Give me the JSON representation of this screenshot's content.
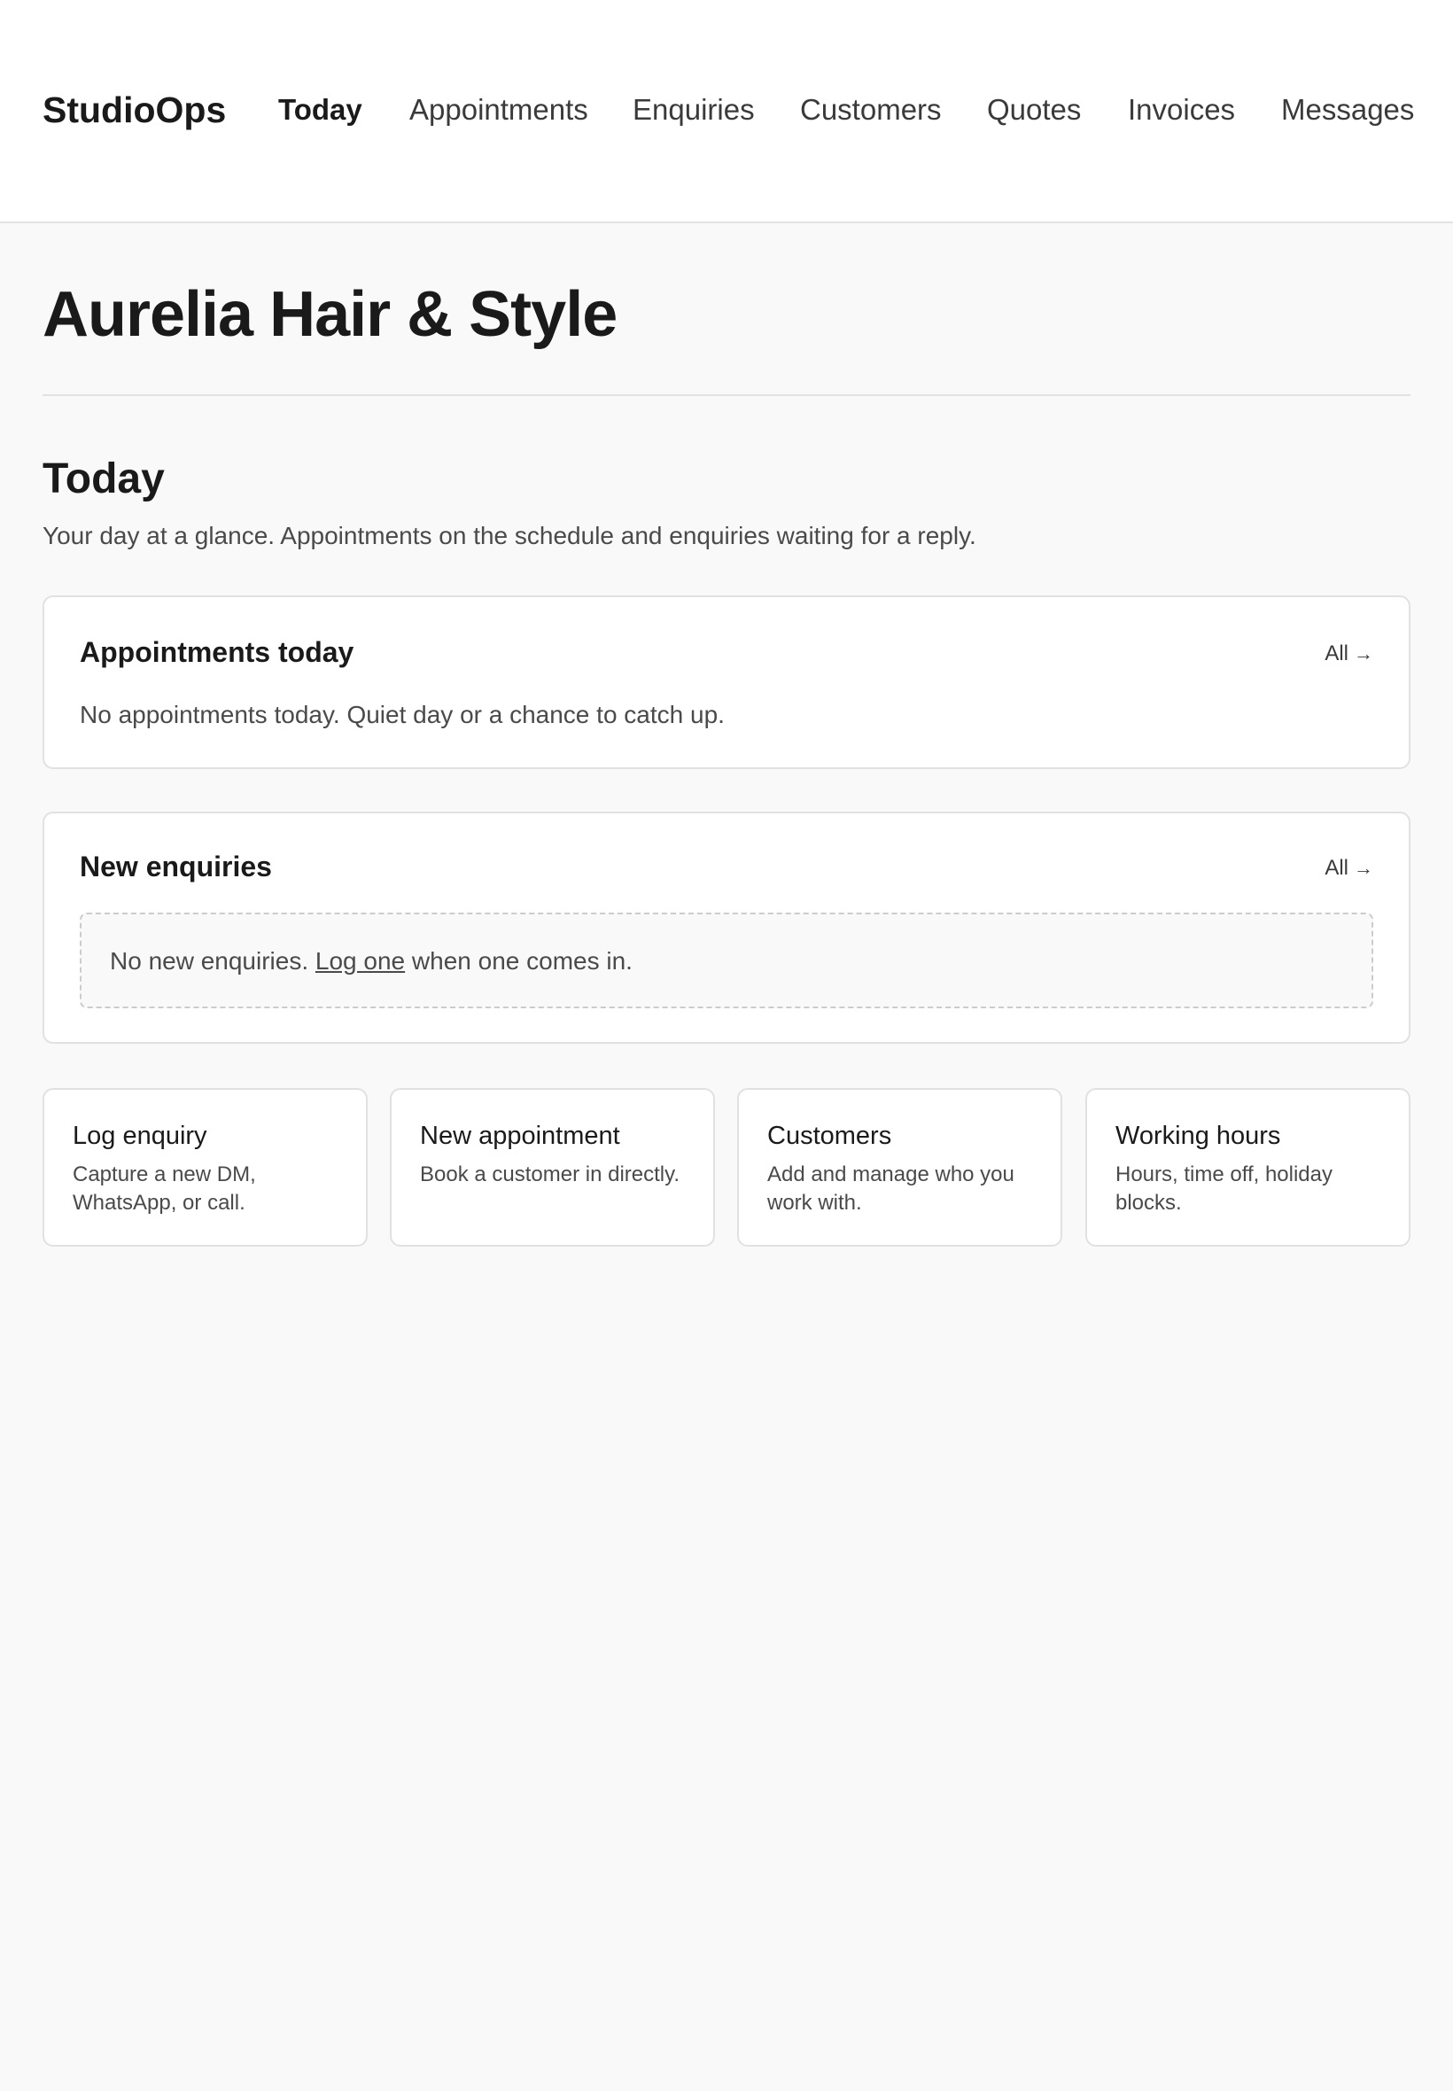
{
  "app": {
    "brand": "StudioOps"
  },
  "nav": {
    "items": [
      {
        "label": "Today",
        "active": true
      },
      {
        "label": "Appointments",
        "active": false
      },
      {
        "label": "Enquiries",
        "active": false
      },
      {
        "label": "Customers",
        "active": false
      },
      {
        "label": "Quotes",
        "active": false
      },
      {
        "label": "Invoices",
        "active": false
      },
      {
        "label": "Messages",
        "active": false
      }
    ]
  },
  "page": {
    "business_name": "Aurelia Hair & Style",
    "section_title": "Today",
    "section_subtitle": "Your day at a glance. Appointments on the schedule and enquiries waiting for a reply."
  },
  "appointments_card": {
    "title": "Appointments today",
    "link_label": "All",
    "empty_text": "No appointments today. Quiet day or a chance to catch up."
  },
  "enquiries_card": {
    "title": "New enquiries",
    "link_label": "All",
    "empty_prefix": "No new enquiries.",
    "empty_link": "Log one",
    "empty_suffix": "when one comes in."
  },
  "quick_actions": [
    {
      "title": "Log enquiry",
      "description": "Capture a new DM, WhatsApp, or call."
    },
    {
      "title": "New appointment",
      "description": "Book a customer in directly."
    },
    {
      "title": "Customers",
      "description": "Add and manage who you work with."
    },
    {
      "title": "Working hours",
      "description": "Hours, time off, holiday blocks."
    }
  ],
  "icons": {
    "card_link_arrow": "arrow-right-icon"
  },
  "colors": {
    "background": "#f9f9f9",
    "surface": "#ffffff",
    "text_primary": "#1a1a1a",
    "text_secondary": "#4a4a4a",
    "border": "#e1e1e1"
  }
}
